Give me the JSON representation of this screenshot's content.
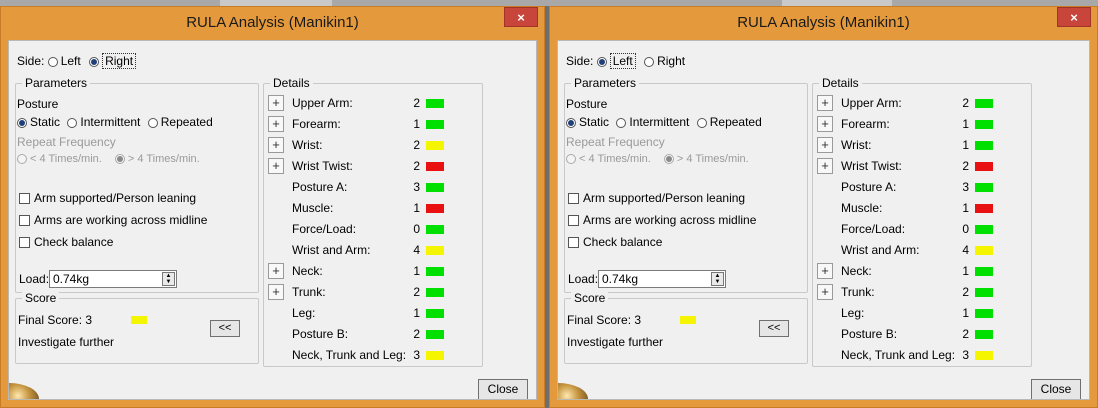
{
  "colors": {
    "green": "#00e000",
    "yellow": "#f5f500",
    "red": "#e81010",
    "frame": "#e49a3c"
  },
  "dialogs": [
    {
      "title": "RULA Analysis (Manikin1)",
      "close_x": "×",
      "side": {
        "label": "Side:",
        "left": "Left",
        "right": "Right",
        "selected": "right"
      },
      "parameters": {
        "legend": "Parameters",
        "posture_label": "Posture",
        "static": "Static",
        "intermittent": "Intermittent",
        "repeated": "Repeated",
        "repeat_frequency_label": "Repeat Frequency",
        "freq_low": "< 4 Times/min.",
        "freq_high": "> 4 Times/min.",
        "arm_supported": "Arm supported/Person leaning",
        "arms_midline": "Arms are working across midline",
        "check_balance": "Check balance",
        "load_label": "Load:",
        "load_value": "0.74kg"
      },
      "score": {
        "legend": "Score",
        "final_label": "Final Score: 3",
        "final_color": "yellow",
        "message": "Investigate further",
        "toggle": "<<"
      },
      "details": {
        "legend": "Details",
        "rows": [
          {
            "label": "Upper Arm:",
            "value": "2",
            "color": "green",
            "expand": "+"
          },
          {
            "label": "Forearm:",
            "value": "1",
            "color": "green",
            "expand": "+"
          },
          {
            "label": "Wrist:",
            "value": "2",
            "color": "yellow",
            "expand": "+"
          },
          {
            "label": "Wrist Twist:",
            "value": "2",
            "color": "red",
            "expand": "+"
          },
          {
            "label": "Posture A:",
            "value": "3",
            "color": "green"
          },
          {
            "label": "Muscle:",
            "value": "1",
            "color": "red"
          },
          {
            "label": "Force/Load:",
            "value": "0",
            "color": "green"
          },
          {
            "label": "Wrist and Arm:",
            "value": "4",
            "color": "yellow"
          },
          {
            "label": "Neck:",
            "value": "1",
            "color": "green",
            "expand": "+"
          },
          {
            "label": "Trunk:",
            "value": "2",
            "color": "green",
            "expand": "+"
          },
          {
            "label": "Leg:",
            "value": "1",
            "color": "green"
          },
          {
            "label": "Posture B:",
            "value": "2",
            "color": "green"
          },
          {
            "label": "Neck, Trunk and Leg:",
            "value": "3",
            "color": "yellow"
          }
        ]
      },
      "close_button": "Close"
    },
    {
      "title": "RULA Analysis (Manikin1)",
      "close_x": "×",
      "side": {
        "label": "Side:",
        "left": "Left",
        "right": "Right",
        "selected": "left"
      },
      "parameters": {
        "legend": "Parameters",
        "posture_label": "Posture",
        "static": "Static",
        "intermittent": "Intermittent",
        "repeated": "Repeated",
        "repeat_frequency_label": "Repeat Frequency",
        "freq_low": "< 4 Times/min.",
        "freq_high": "> 4 Times/min.",
        "arm_supported": "Arm supported/Person leaning",
        "arms_midline": "Arms are working across midline",
        "check_balance": "Check balance",
        "load_label": "Load:",
        "load_value": "0.74kg"
      },
      "score": {
        "legend": "Score",
        "final_label": "Final Score: 3",
        "final_color": "yellow",
        "message": "Investigate further",
        "toggle": "<<"
      },
      "details": {
        "legend": "Details",
        "rows": [
          {
            "label": "Upper Arm:",
            "value": "2",
            "color": "green",
            "expand": "+"
          },
          {
            "label": "Forearm:",
            "value": "1",
            "color": "green",
            "expand": "+"
          },
          {
            "label": "Wrist:",
            "value": "1",
            "color": "green",
            "expand": "+"
          },
          {
            "label": "Wrist Twist:",
            "value": "2",
            "color": "red",
            "expand": "+"
          },
          {
            "label": "Posture A:",
            "value": "3",
            "color": "green"
          },
          {
            "label": "Muscle:",
            "value": "1",
            "color": "red"
          },
          {
            "label": "Force/Load:",
            "value": "0",
            "color": "green"
          },
          {
            "label": "Wrist and Arm:",
            "value": "4",
            "color": "yellow"
          },
          {
            "label": "Neck:",
            "value": "1",
            "color": "green",
            "expand": "+"
          },
          {
            "label": "Trunk:",
            "value": "2",
            "color": "green",
            "expand": "+"
          },
          {
            "label": "Leg:",
            "value": "1",
            "color": "green"
          },
          {
            "label": "Posture B:",
            "value": "2",
            "color": "green"
          },
          {
            "label": "Neck, Trunk and Leg:",
            "value": "3",
            "color": "yellow"
          }
        ]
      },
      "close_button": "Close"
    }
  ]
}
